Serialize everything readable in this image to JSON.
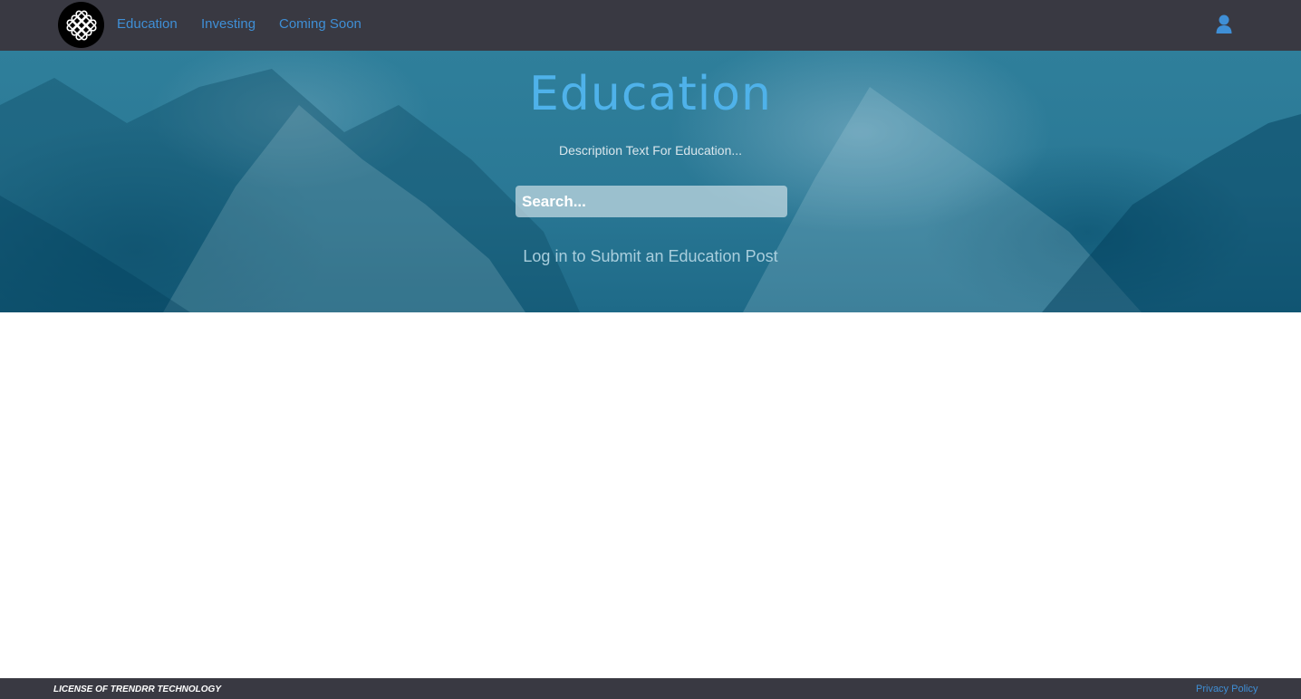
{
  "nav": {
    "links": [
      "Education",
      "Investing",
      "Coming Soon"
    ]
  },
  "hero": {
    "title": "Education",
    "description": "Description Text For Education...",
    "search_placeholder": "Search...",
    "login_link": "Log in to Submit an Education Post"
  },
  "footer": {
    "license": "LICENSE OF TRENDRR TECHNOLOGY",
    "privacy": "Privacy Policy"
  },
  "icons": [
    "logo-knot-icon",
    "user-icon"
  ],
  "colors": {
    "navbar": "#393942",
    "link": "#3f8fd6",
    "hero_title": "#4fb2ea",
    "hero_tint": "#2a7895"
  }
}
